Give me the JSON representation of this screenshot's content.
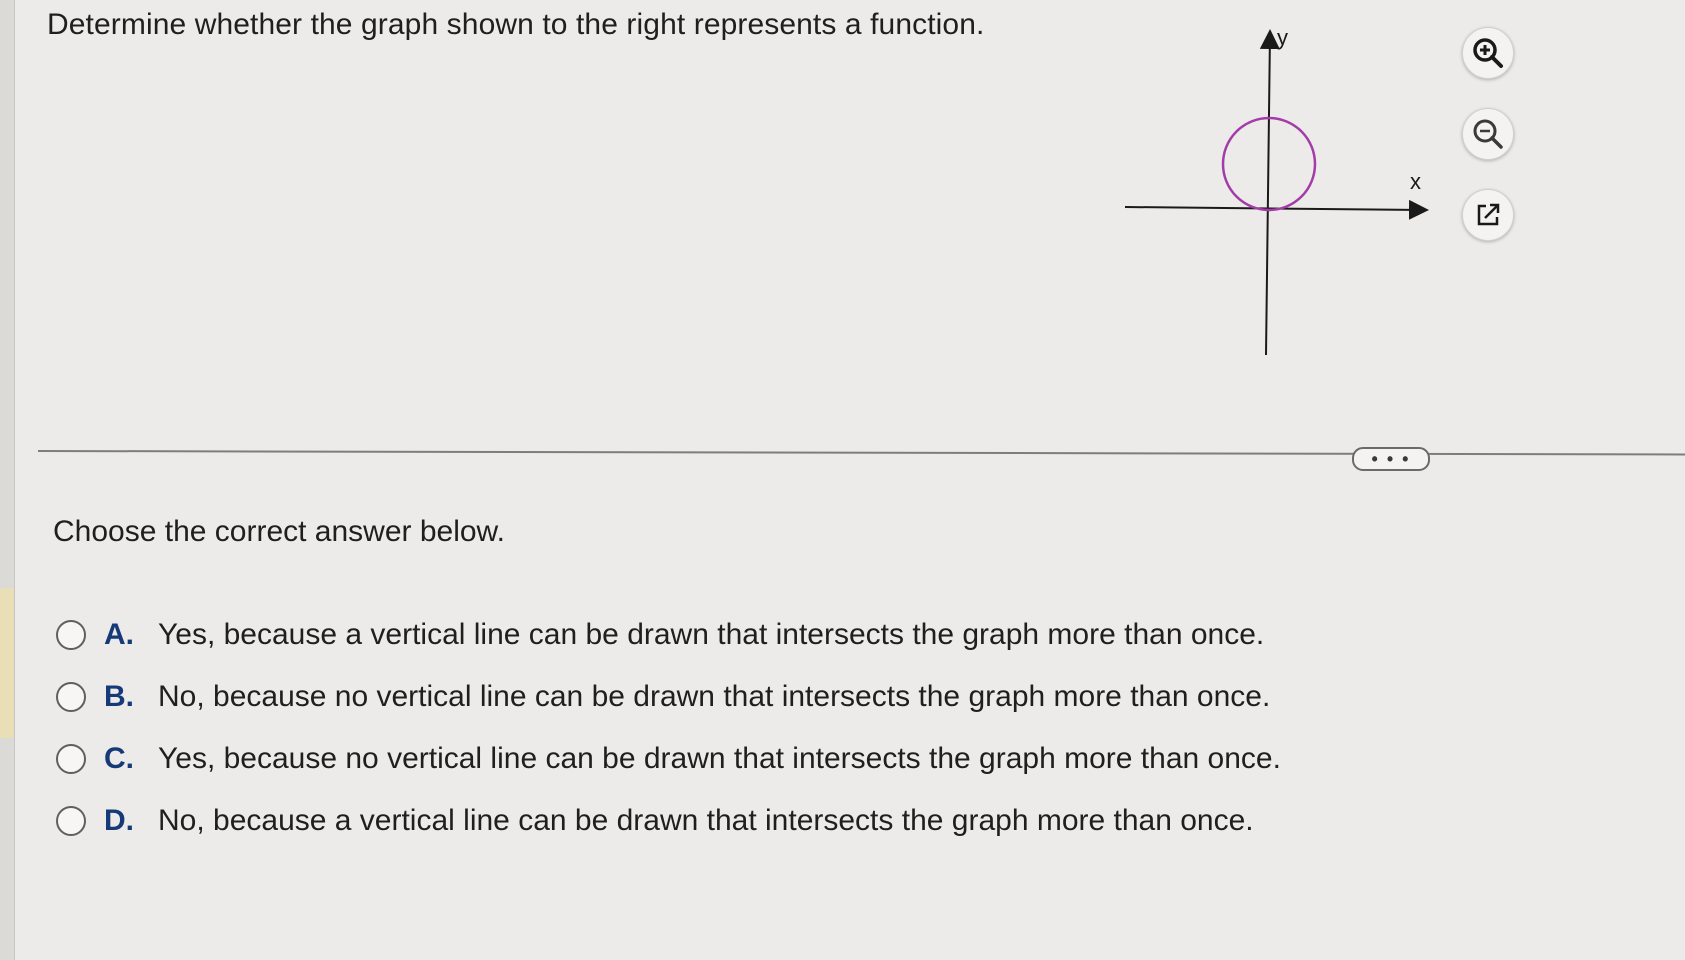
{
  "question": {
    "text": "Determine whether the graph shown to the right represents a function."
  },
  "graph": {
    "x_label": "x",
    "y_label": "y",
    "curve_color": "#a33ca8",
    "axis_color": "#1a1a1a"
  },
  "toolbar": {
    "zoom_in_icon": "zoom-in-icon",
    "zoom_out_icon": "zoom-out-icon",
    "open_icon": "open-new-window-icon"
  },
  "divider": {
    "more_label": "• • •"
  },
  "prompt": {
    "text": "Choose the correct answer below."
  },
  "choices": [
    {
      "letter": "A.",
      "text": "Yes, because a vertical line can be drawn that intersects the graph more than once."
    },
    {
      "letter": "B.",
      "text": "No, because no vertical line can be drawn that intersects the graph more than once."
    },
    {
      "letter": "C.",
      "text": "Yes, because no vertical line can be drawn that intersects the graph more than once."
    },
    {
      "letter": "D.",
      "text": "No, because a vertical line can be drawn that intersects the graph more than once."
    }
  ],
  "colors": {
    "background": "#ecebe9",
    "choice_letter": "#163a78",
    "text": "#1f1f1f"
  }
}
